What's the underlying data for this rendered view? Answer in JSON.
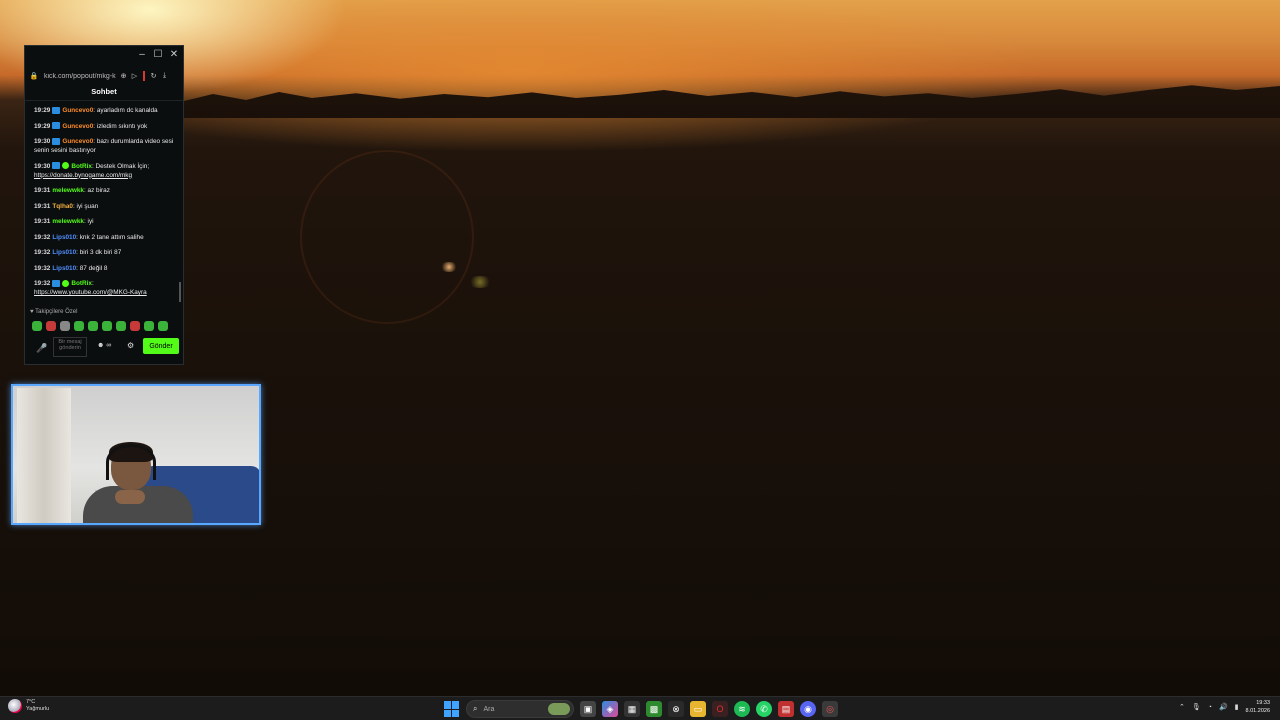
{
  "chat": {
    "url": "kick.com/popout/mkg-k",
    "title": "Sohbet",
    "messages": [
      {
        "time": "19:29",
        "user": "Guncevo0",
        "user_color": "#ff8c2a",
        "text": ": ayarladım dc kanalda",
        "badge": true
      },
      {
        "time": "19:29",
        "user": "Guncevo0",
        "user_color": "#ff8c2a",
        "text": ": izledim sıkıntı yok",
        "badge": true
      },
      {
        "time": "19:30",
        "user": "Guncevo0",
        "user_color": "#ff8c2a",
        "text": ": bazı durumlarda video sesi senin sesini bastırıyor",
        "badge": true
      },
      {
        "time": "19:30",
        "user": "BotRix",
        "user_color": "#53fc18",
        "text": ": Destek Olmak İçin;",
        "link": "https://donate.bynogame.com/mkg",
        "badge": true,
        "verified": true
      },
      {
        "time": "19:31",
        "user": "melewwkk",
        "user_color": "#53fc18",
        "text": ": az biraz"
      },
      {
        "time": "19:31",
        "user": "Tqlha0",
        "user_color": "#f5b041",
        "text": ": iyi şuan"
      },
      {
        "time": "19:31",
        "user": "melewwkk",
        "user_color": "#53fc18",
        "text": ": iyi"
      },
      {
        "time": "19:32",
        "user": "Lips010",
        "user_color": "#4f8fff",
        "text": ": knk 2 tane attım salihe"
      },
      {
        "time": "19:32",
        "user": "Lips010",
        "user_color": "#4f8fff",
        "text": ": biri 3 dk biri 87"
      },
      {
        "time": "19:32",
        "user": "Lips010",
        "user_color": "#4f8fff",
        "text": ": 87 değil 8"
      },
      {
        "time": "19:32",
        "user": "BotRix",
        "user_color": "#53fc18",
        "text": ":",
        "link": "https://www.youtube.com/@MKG-Kayra",
        "badge": true,
        "verified": true
      }
    ],
    "followers_label": "♥ Takipçilere Özel",
    "input_placeholder": "Bir mesaj gönderin",
    "send_label": "Gönder"
  },
  "taskbar": {
    "weather_temp": "7°C",
    "weather_desc": "Yağmurlu",
    "search_placeholder": "Ara",
    "time": "19:33",
    "date": "8.01.2026"
  },
  "colors": {
    "accent": "#53fc18",
    "webcam_border": "#5aa7ff"
  }
}
